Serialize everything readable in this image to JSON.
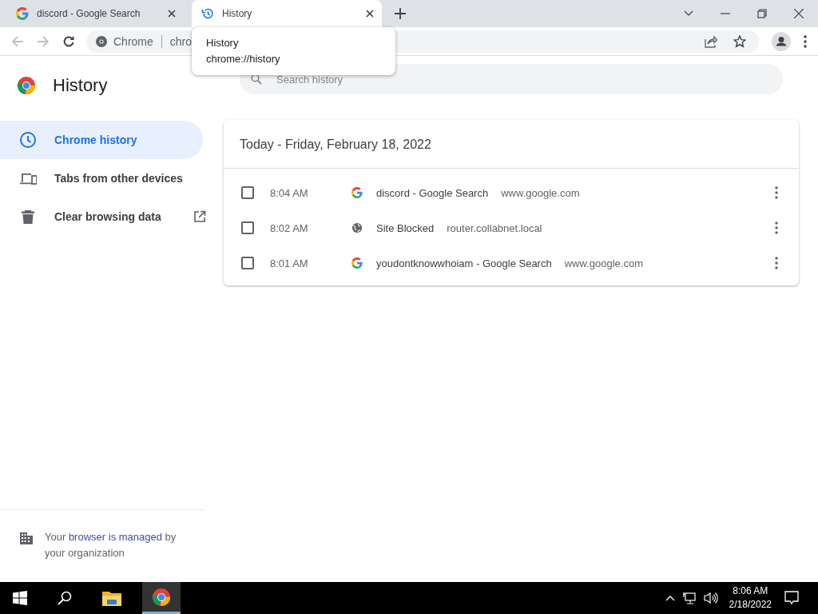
{
  "tabs": [
    {
      "title": "discord - Google Search",
      "kind": "google",
      "selected": false
    },
    {
      "title": "History",
      "kind": "history",
      "selected": true
    }
  ],
  "omnibox": {
    "site_label": "Chrome",
    "url": "chro"
  },
  "tooltip": {
    "title": "History",
    "url": "chrome://history"
  },
  "page_title": "History",
  "search": {
    "placeholder": "Search history"
  },
  "sidebar": {
    "items": [
      {
        "label": "Chrome history",
        "kind": "clock",
        "selected": true,
        "external_link": false
      },
      {
        "label": "Tabs from other devices",
        "kind": "devices",
        "selected": false,
        "external_link": false
      },
      {
        "label": "Clear browsing data",
        "kind": "trash",
        "selected": false,
        "external_link": true
      }
    ]
  },
  "managed": {
    "before": "Your",
    "link": "browser is managed",
    "after": "by your organization"
  },
  "history": {
    "heading": "Today - Friday, February 18, 2022",
    "entries": [
      {
        "time": "8:04 AM",
        "kind": "google",
        "title": "discord - Google Search",
        "domain": "www.google.com",
        "checked": false
      },
      {
        "time": "8:02 AM",
        "kind": "globe",
        "title": "Site Blocked",
        "domain": "router.collabnet.local",
        "checked": false
      },
      {
        "time": "8:01 AM",
        "kind": "google",
        "title": "youdontknowwhoiam - Google Search",
        "domain": "www.google.com",
        "checked": false
      }
    ]
  },
  "taskbar": {
    "time": "8:06 AM",
    "date": "2/18/2022"
  }
}
